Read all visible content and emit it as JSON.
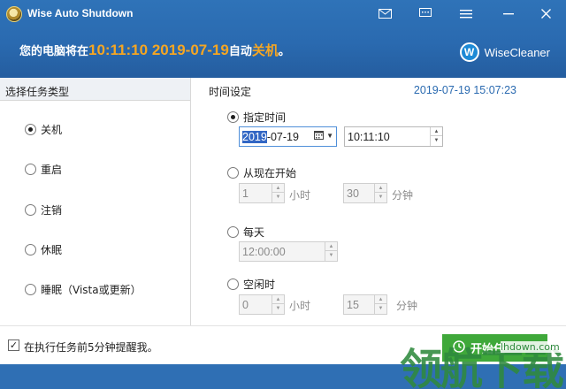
{
  "window": {
    "title": "Wise Auto Shutdown"
  },
  "titlebar": {
    "icons": [
      "mail-icon",
      "feedback-icon",
      "menu-icon",
      "minimize-icon",
      "close-icon"
    ]
  },
  "banner": {
    "prefix": "您的电脑将在",
    "time": "10:11:10 2019-07-19",
    "middle": "自动",
    "action": "关机",
    "suffix": "。"
  },
  "brand": {
    "logo_letter": "W",
    "name": "WiseCleaner"
  },
  "task_panel": {
    "heading": "选择任务类型",
    "options": [
      {
        "label": "关机",
        "checked": true
      },
      {
        "label": "重启",
        "checked": false
      },
      {
        "label": "注销",
        "checked": false
      },
      {
        "label": "休眠",
        "checked": false
      },
      {
        "label": "睡眠（Vista或更新）",
        "checked": false
      }
    ]
  },
  "time_panel": {
    "heading": "时间设定",
    "current_datetime": "2019-07-19 15:07:23",
    "specified": {
      "label": "指定时间",
      "checked": true,
      "date_year": "2019",
      "date_rest": "-07-19",
      "time": "10:11:10"
    },
    "from_now": {
      "label": "从现在开始",
      "checked": false,
      "hours": "1",
      "hours_unit": "小时",
      "minutes": "30",
      "minutes_unit": "分钟"
    },
    "daily": {
      "label": "每天",
      "checked": false,
      "time": "12:00:00"
    },
    "idle": {
      "label": "空闲时",
      "checked": false,
      "hours": "0",
      "hours_unit": "小时",
      "minutes": "15",
      "minutes_unit": "分钟"
    }
  },
  "footer": {
    "remind_label": "在执行任务前5分钟提醒我。",
    "remind_checked": true,
    "start_label": "开始任"
  },
  "watermark": {
    "text": "领航下载",
    "url": "lhdown.com"
  },
  "colors": {
    "header": "#2a6ab0",
    "accent": "#f5a623",
    "start_button": "#3fa83a",
    "link": "#2a6ab0"
  }
}
